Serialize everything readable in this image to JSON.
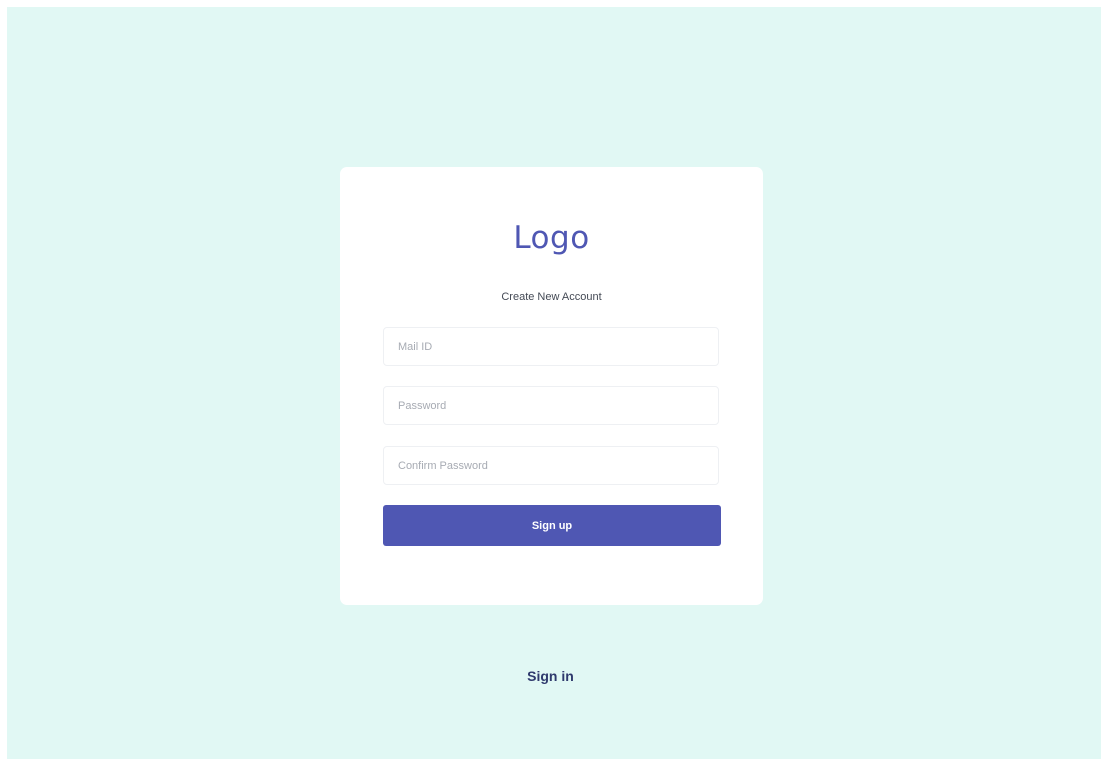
{
  "card": {
    "logo_text": "Logo",
    "subtitle": "Create New Account"
  },
  "form": {
    "mail": {
      "placeholder": "Mail ID",
      "value": ""
    },
    "password": {
      "placeholder": "Password",
      "value": ""
    },
    "confirm_password": {
      "placeholder": "Confirm Password",
      "value": ""
    },
    "submit_label": "Sign up"
  },
  "footer": {
    "signin_label": "Sign in"
  },
  "colors": {
    "background": "#e1f8f4",
    "card": "#ffffff",
    "accent": "#4f57b3",
    "link": "#2f3a6d"
  }
}
